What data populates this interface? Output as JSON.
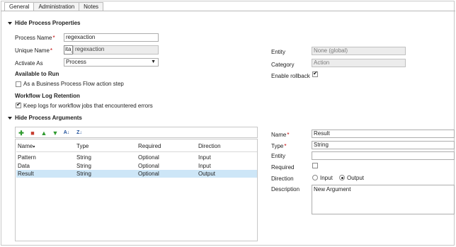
{
  "tabs": [
    {
      "label": "General"
    },
    {
      "label": "Administration"
    },
    {
      "label": "Notes"
    }
  ],
  "properties": {
    "section_title": "Hide Process Properties",
    "process_name_label": "Process Name",
    "process_name_value": "regexaction",
    "unique_name_label": "Unique Name",
    "unique_name_prefix": "ita_",
    "unique_name_value": "regexaction",
    "activate_as_label": "Activate As",
    "activate_as_value": "Process",
    "available_heading": "Available to Run",
    "bpf_label": "As a Business Process Flow action step",
    "log_heading": "Workflow Log Retention",
    "log_label": "Keep logs for workflow jobs that encountered errors",
    "entity_label": "Entity",
    "entity_value": "None (global)",
    "category_label": "Category",
    "category_value": "Action",
    "rollback_label": "Enable rollback"
  },
  "arguments": {
    "section_title": "Hide Process Arguments",
    "columns": [
      "Name",
      "Type",
      "Required",
      "Direction"
    ],
    "rows": [
      {
        "name": "Pattern",
        "type": "String",
        "required": "Optional",
        "direction": "Input"
      },
      {
        "name": "Data",
        "type": "String",
        "required": "Optional",
        "direction": "Input"
      },
      {
        "name": "Result",
        "type": "String",
        "required": "Optional",
        "direction": "Output"
      }
    ]
  },
  "detail": {
    "name_label": "Name",
    "name_value": "Result",
    "type_label": "Type",
    "type_value": "String",
    "entity_label": "Entity",
    "entity_value": "",
    "required_label": "Required",
    "direction_label": "Direction",
    "direction_input": "Input",
    "direction_output": "Output",
    "description_label": "Description",
    "description_value": "New Argument"
  },
  "icons": {
    "add": "add-icon",
    "delete": "delete-icon",
    "up": "move-up-icon",
    "down": "move-down-icon",
    "sort_asc": "sort-ascending-icon",
    "sort_desc": "sort-descending-icon"
  }
}
